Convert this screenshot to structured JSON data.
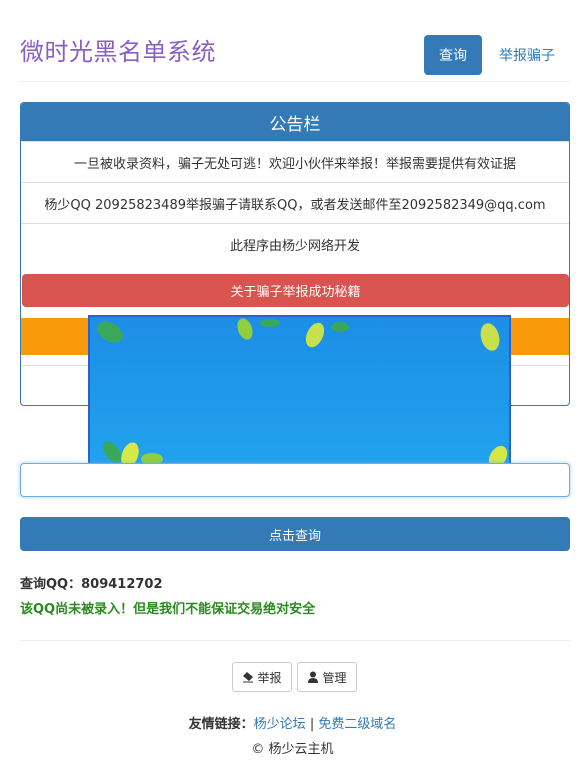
{
  "header": {
    "title": "微时光黑名单系统",
    "nav": {
      "query": "查询",
      "report": "举报骗子"
    }
  },
  "notice_panel": {
    "heading": "公告栏",
    "rows": [
      "一旦被收录资料，骗子无处可逃！欢迎小伙伴来举报！举报需要提供有效证据",
      "杨少QQ 20925823489举报骗子请联系QQ，或者发送邮件至2092582349@qq.com",
      "此程序由杨少网络开发"
    ],
    "red_button": "关于骗子举报成功秘籍"
  },
  "search": {
    "input_value": "",
    "submit_label": "点击查询"
  },
  "result": {
    "query_label": "查询QQ：",
    "query_value": "809412702",
    "status": "该QQ尚未被录入！但是我们不能保证交易绝对安全"
  },
  "footer": {
    "report_button": "举报",
    "admin_button": "管理",
    "links_label": "友情链接：",
    "links": [
      "杨少论坛",
      "免费二级域名"
    ],
    "separator": "|",
    "copyright": "© 杨少云主机"
  },
  "colors": {
    "primary": "#337ab7",
    "danger": "#d9534f",
    "warning": "#f99a0a",
    "title": "#8a5fc4",
    "success_text": "#2b8a1f",
    "banner": "#1b96e8"
  },
  "icons": {
    "report": "eraser-icon",
    "admin": "user-icon"
  }
}
